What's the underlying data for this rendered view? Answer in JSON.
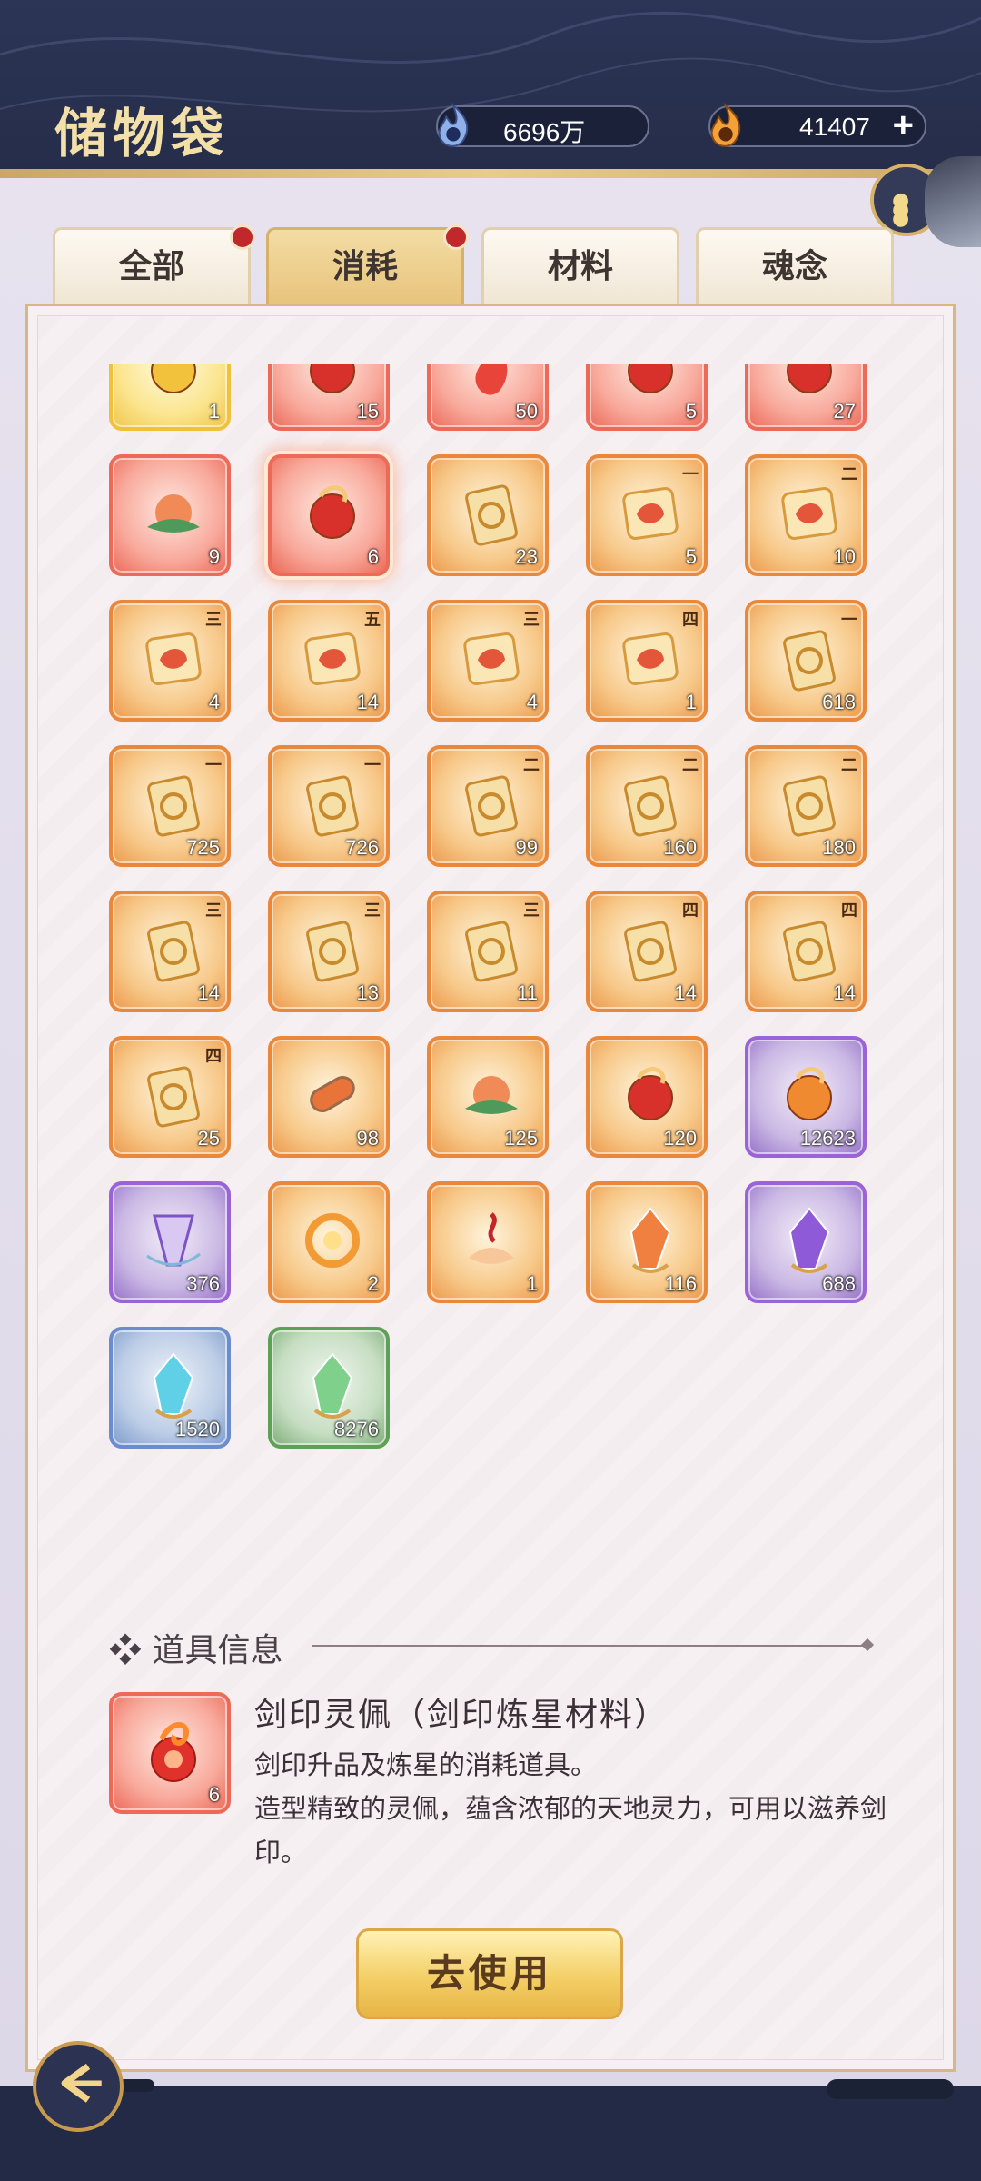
{
  "header": {
    "title": "储物袋",
    "currency_spirit": "6696万",
    "currency_fire": "41407",
    "plus_label": "+"
  },
  "tabs": [
    {
      "label": "全部",
      "has_dot": true
    },
    {
      "label": "消耗",
      "has_dot": true,
      "active": true
    },
    {
      "label": "材料"
    },
    {
      "label": "魂念"
    }
  ],
  "items": [
    {
      "count": "1",
      "rarity": "gold",
      "icon": "gold-orb-icon"
    },
    {
      "count": "15",
      "rarity": "red",
      "icon": "red-scroll-icon"
    },
    {
      "count": "50",
      "rarity": "red",
      "icon": "red-flame-icon"
    },
    {
      "count": "5",
      "rarity": "red",
      "icon": "red-scroll-icon"
    },
    {
      "count": "27",
      "rarity": "red",
      "icon": "red-scroll-icon"
    },
    {
      "count": "9",
      "rarity": "red",
      "icon": "peach-fruit-icon"
    },
    {
      "count": "6",
      "rarity": "red",
      "icon": "sword-seal-pendant-icon",
      "selected": true
    },
    {
      "count": "23",
      "rarity": "orange",
      "icon": "seal-token-icon"
    },
    {
      "count": "5",
      "rarity": "orange",
      "icon": "dragon-seal-icon",
      "rank": "一"
    },
    {
      "count": "10",
      "rarity": "orange",
      "icon": "dragon-seal-icon",
      "rank": "二"
    },
    {
      "count": "4",
      "rarity": "orange",
      "icon": "dragon-seal-icon",
      "rank": "三"
    },
    {
      "count": "14",
      "rarity": "orange",
      "icon": "dragon-seal-icon",
      "rank": "五"
    },
    {
      "count": "4",
      "rarity": "orange",
      "icon": "fish-seal-icon",
      "rank": "三"
    },
    {
      "count": "1",
      "rarity": "orange",
      "icon": "fish-seal-icon",
      "rank": "四"
    },
    {
      "count": "618",
      "rarity": "orange",
      "icon": "scroll-book-icon",
      "rank": "一"
    },
    {
      "count": "725",
      "rarity": "orange",
      "icon": "scroll-book-icon",
      "rank": "一"
    },
    {
      "count": "726",
      "rarity": "orange",
      "icon": "scroll-book-icon",
      "rank": "一"
    },
    {
      "count": "99",
      "rarity": "orange",
      "icon": "scroll-book-icon",
      "rank": "二"
    },
    {
      "count": "160",
      "rarity": "orange",
      "icon": "scroll-book-icon",
      "rank": "二"
    },
    {
      "count": "180",
      "rarity": "orange",
      "icon": "scroll-book-icon",
      "rank": "二"
    },
    {
      "count": "14",
      "rarity": "orange",
      "icon": "scroll-book-icon",
      "rank": "三"
    },
    {
      "count": "13",
      "rarity": "orange",
      "icon": "scroll-book-icon",
      "rank": "三"
    },
    {
      "count": "11",
      "rarity": "orange",
      "icon": "scroll-book-icon",
      "rank": "三"
    },
    {
      "count": "14",
      "rarity": "orange",
      "icon": "scroll-book-icon",
      "rank": "四"
    },
    {
      "count": "14",
      "rarity": "orange",
      "icon": "scroll-book-icon",
      "rank": "四"
    },
    {
      "count": "25",
      "rarity": "orange",
      "icon": "scroll-book-icon",
      "rank": "四"
    },
    {
      "count": "98",
      "rarity": "orange",
      "icon": "rolled-scroll-icon"
    },
    {
      "count": "125",
      "rarity": "orange",
      "icon": "peach-fruit-icon"
    },
    {
      "count": "120",
      "rarity": "orange",
      "icon": "red-orb-icon"
    },
    {
      "count": "12623",
      "rarity": "purple",
      "icon": "orange-orb-icon"
    },
    {
      "count": "376",
      "rarity": "purple",
      "icon": "purple-ribbon-icon"
    },
    {
      "count": "2",
      "rarity": "orange",
      "icon": "golden-ring-icon"
    },
    {
      "count": "1",
      "rarity": "orange",
      "icon": "lotus-flame-icon"
    },
    {
      "count": "116",
      "rarity": "orange",
      "icon": "orange-crystal-icon"
    },
    {
      "count": "688",
      "rarity": "purple",
      "icon": "purple-crystal-icon"
    },
    {
      "count": "1520",
      "rarity": "blue",
      "icon": "blue-crystal-icon"
    },
    {
      "count": "8276",
      "rarity": "green",
      "icon": "green-crystal-icon"
    }
  ],
  "info": {
    "header": "道具信息",
    "header_marker": "❖",
    "name": "剑印灵佩（剑印炼星材料）",
    "desc1": "剑印升品及炼星的消耗道具。",
    "desc2": "造型精致的灵佩，蕴含浓郁的天地灵力，可用以滋养剑印。",
    "item_count": "6"
  },
  "use_button": "去使用",
  "colors": {
    "orange": "#e9883a",
    "red": "#ec6a57",
    "purple": "#9a63d8",
    "blue": "#6b8ccf",
    "green": "#5ea057",
    "gold": "#f0c23c"
  }
}
